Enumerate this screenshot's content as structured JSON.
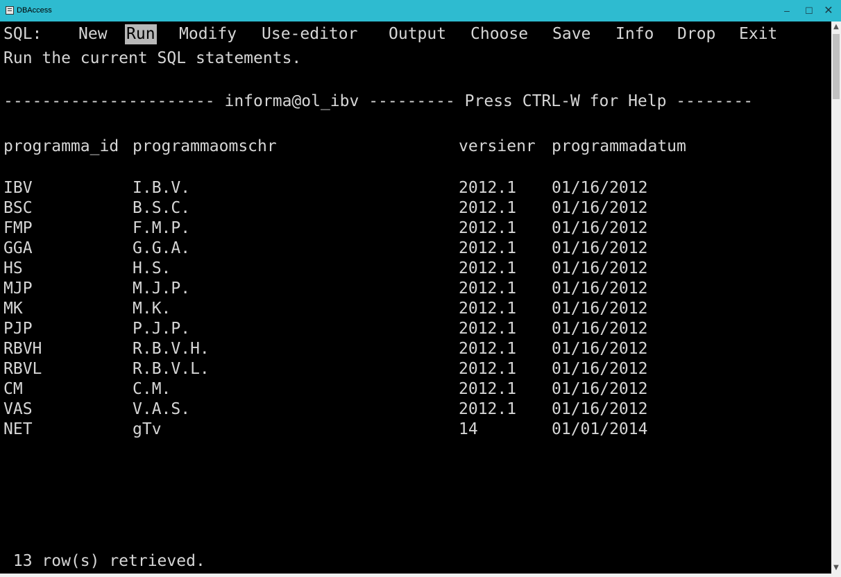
{
  "window": {
    "title": "DBAccess",
    "minimize": "–",
    "maximize": "☐",
    "close": "✕"
  },
  "menu": {
    "prompt": "SQL:",
    "items": [
      {
        "label": "New",
        "active": false
      },
      {
        "label": "Run",
        "active": true
      },
      {
        "label": "Modify",
        "active": false
      },
      {
        "label": "Use-editor",
        "active": false
      },
      {
        "label": "Output",
        "active": false
      },
      {
        "label": "Choose",
        "active": false
      },
      {
        "label": "Save",
        "active": false
      },
      {
        "label": "Info",
        "active": false
      },
      {
        "label": "Drop",
        "active": false
      },
      {
        "label": "Exit",
        "active": false
      }
    ],
    "description": "Run the current SQL statements."
  },
  "status_line": "---------------------- informa@ol_ibv --------- Press CTRL-W for Help --------",
  "table": {
    "columns": [
      "programma_id",
      "programmaomschr",
      "versienr",
      "programmadatum"
    ],
    "rows": [
      [
        "IBV",
        "I.B.V.",
        "2012.1",
        "01/16/2012"
      ],
      [
        "BSC",
        "B.S.C.",
        "2012.1",
        "01/16/2012"
      ],
      [
        "FMP",
        "F.M.P.",
        "2012.1",
        "01/16/2012"
      ],
      [
        "GGA",
        "G.G.A.",
        "2012.1",
        "01/16/2012"
      ],
      [
        "HS",
        "H.S.",
        "2012.1",
        "01/16/2012"
      ],
      [
        "MJP",
        "M.J.P.",
        "2012.1",
        "01/16/2012"
      ],
      [
        "MK",
        "M.K.",
        "2012.1",
        "01/16/2012"
      ],
      [
        "PJP",
        "P.J.P.",
        "2012.1",
        "01/16/2012"
      ],
      [
        "RBVH",
        "R.B.V.H.",
        "2012.1",
        "01/16/2012"
      ],
      [
        "RBVL",
        "R.B.V.L.",
        "2012.1",
        "01/16/2012"
      ],
      [
        "CM",
        "C.M.",
        "2012.1",
        "01/16/2012"
      ],
      [
        "VAS",
        "V.A.S.",
        "2012.1",
        "01/16/2012"
      ],
      [
        "NET",
        "gTv",
        "14",
        "01/01/2014"
      ]
    ]
  },
  "footer": " 13 row(s) retrieved.",
  "scrollbar": {
    "up": "▲",
    "down": "▼"
  },
  "colors": {
    "titlebar": "#2ebbd0",
    "terminal_bg": "#000000",
    "terminal_fg": "#d6d6d6",
    "highlight_bg": "#b8b8b8"
  }
}
